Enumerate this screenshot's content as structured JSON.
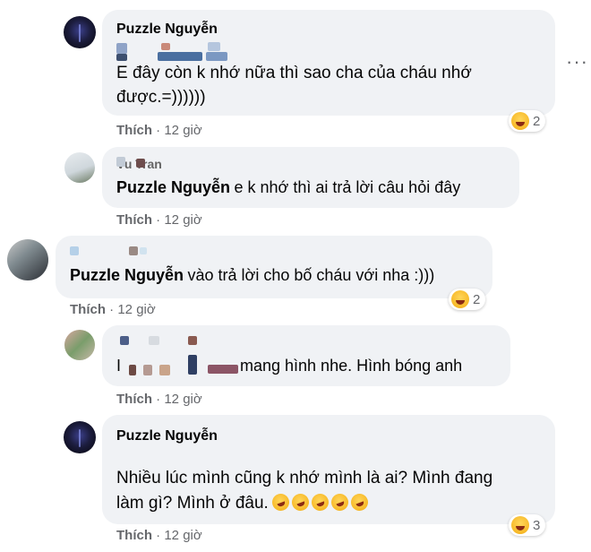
{
  "comments": [
    {
      "author": "Puzzle Nguyễn",
      "lines": [
        "E đây còn k nhớ nữa thì sao cha của cháu nhớ",
        "được.=))))))"
      ],
      "like": "Thích",
      "time": "12 giờ",
      "reaction_count": "2"
    },
    {
      "author_partial": "Vu Tran",
      "mention": "Puzzle Nguyễn",
      "text": "e k nhớ thì ai trả lời câu hỏi đây",
      "like": "Thích",
      "time": "12 giờ"
    },
    {
      "mention": "Puzzle Nguyễn",
      "text": "vào trả lời cho bố cháu với nha :)))",
      "like": "Thích",
      "time": "12 giờ",
      "reaction_count": "2"
    },
    {
      "prefix": "I",
      "text": "mang hình nhe. Hình bóng anh",
      "like": "Thích",
      "time": "12 giờ"
    },
    {
      "author": "Puzzle Nguyễn",
      "lines": [
        "Nhiều lúc mình cũng k nhớ mình là ai? Mình đang",
        "làm gì? Mình ở đâu."
      ],
      "like": "Thích",
      "time": "12 giờ",
      "reaction_count": "3"
    }
  ],
  "separator": "·",
  "more_options": "···",
  "colors": {
    "bubble": "#f0f2f5",
    "meta": "#65676b",
    "text": "#050505"
  }
}
